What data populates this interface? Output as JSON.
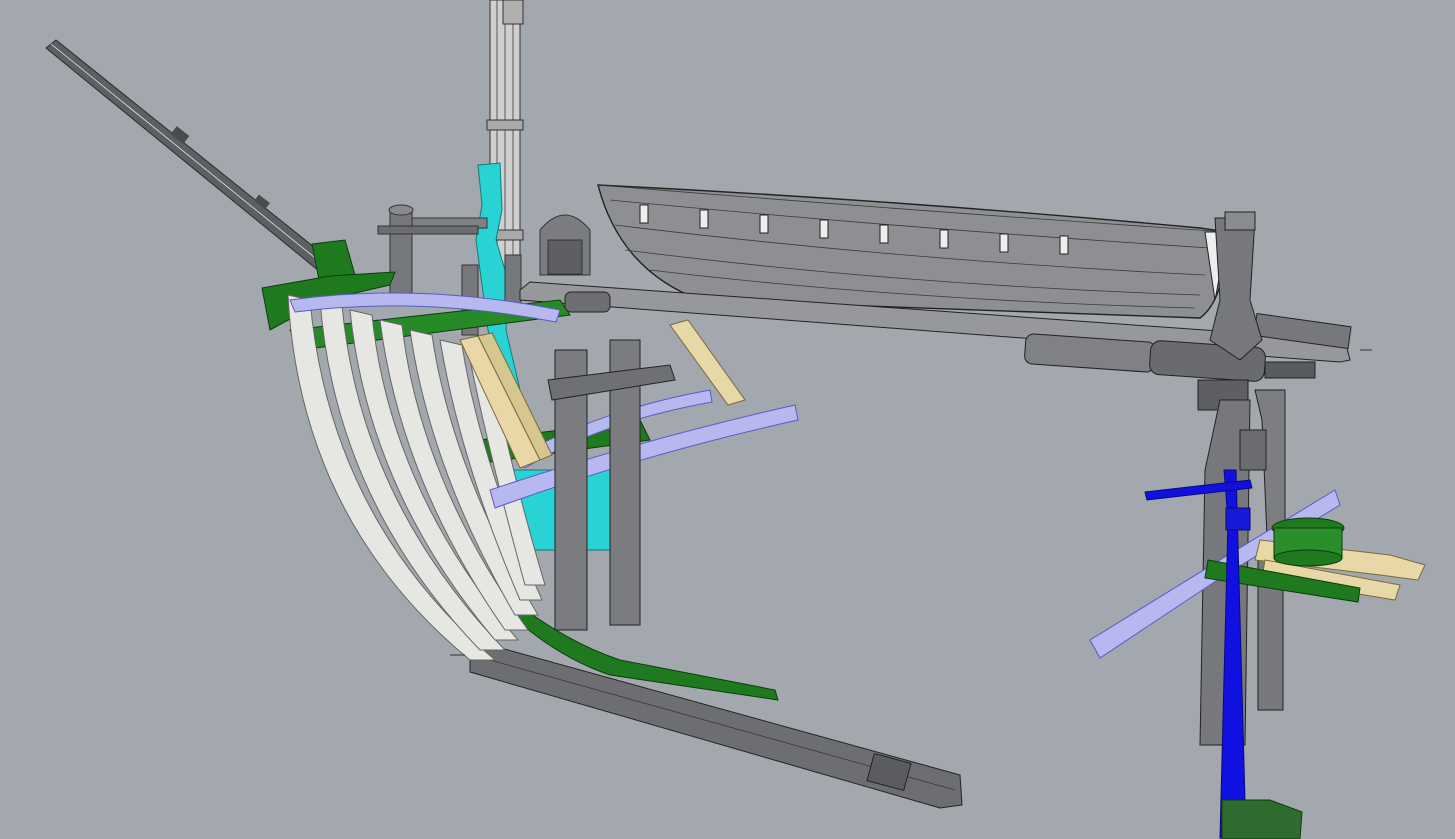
{
  "viewport": {
    "background": "#a3a8ae",
    "colors": {
      "grey_part": "#6f7073",
      "grey_light": "#c8c8c8",
      "green_part": "#1f7a1f",
      "cyan_part": "#2ad3d3",
      "blue_part": "#1010e0",
      "tan_part": "#e8d8a8",
      "lavender_part": "#b7b8f0",
      "white_frames": "#e6e6e2",
      "dark_green_box": "#2e6b2e"
    },
    "objects": [
      "bowsprit",
      "foremast",
      "hull-frames",
      "keel",
      "longboat",
      "boom-spar",
      "stern-post-assembly",
      "ladders",
      "deck-beams",
      "blue-post",
      "green-box"
    ]
  }
}
